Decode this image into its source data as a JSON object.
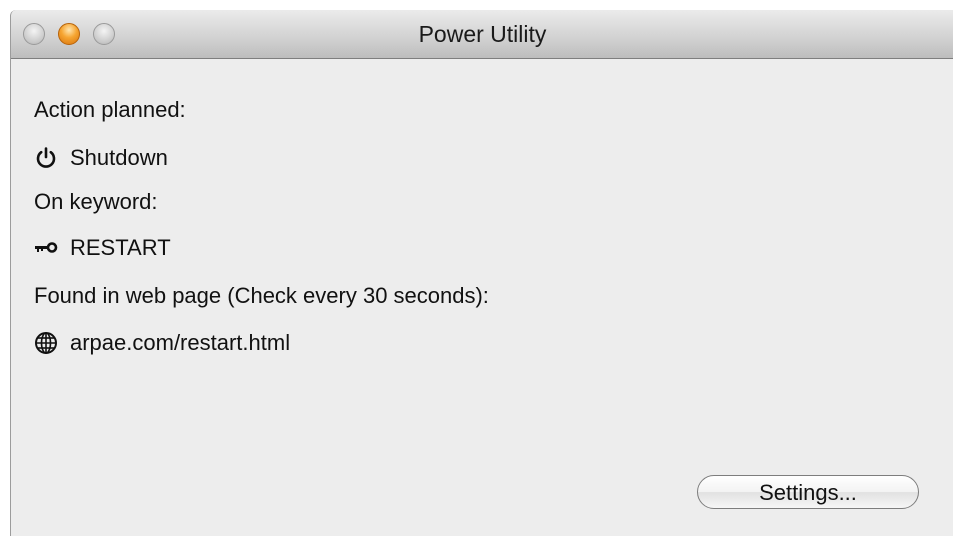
{
  "window": {
    "title": "Power Utility"
  },
  "content": {
    "action_label": "Action planned:",
    "action_value": "Shutdown",
    "action_icon": "power-icon",
    "keyword_label": "On keyword:",
    "keyword_value": "RESTART",
    "keyword_icon": "key-icon",
    "source_label": "Found in web page (Check every 30 seconds):",
    "source_value": "arpae.com/restart.html",
    "source_icon": "globe-icon"
  },
  "buttons": {
    "settings_label": "Settings..."
  }
}
